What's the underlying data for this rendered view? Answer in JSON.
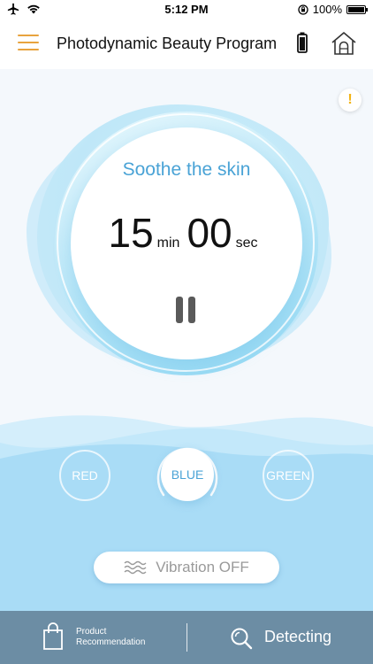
{
  "status_bar": {
    "time": "5:12 PM",
    "battery_text": "100%",
    "icons": [
      "airplane-icon",
      "wifi-icon",
      "orientation-lock-icon",
      "battery-icon"
    ]
  },
  "header": {
    "title": "Photodynamic Beauty Program",
    "icons": [
      "menu-icon",
      "device-battery-icon",
      "home-icon"
    ]
  },
  "colors": {
    "accent": "#e8a33e",
    "primary_blue": "#4aa3d6",
    "water": "#bde6fa",
    "bottom_bar": "#6c8da4"
  },
  "session": {
    "mode_label": "Soothe the skin",
    "minutes": "15",
    "minutes_unit": "min",
    "seconds": "00",
    "seconds_unit": "sec",
    "state": "running"
  },
  "light_modes": {
    "items": [
      {
        "label": "RED",
        "selected": false
      },
      {
        "label": "BLUE",
        "selected": true
      },
      {
        "label": "GREEN",
        "selected": false
      }
    ]
  },
  "vibration": {
    "label": "Vibration OFF",
    "icon": "wave-icon"
  },
  "bottom_bar": {
    "product_label_line1": "Product",
    "product_label_line2": "Recommendation",
    "detect_label": "Detecting"
  }
}
